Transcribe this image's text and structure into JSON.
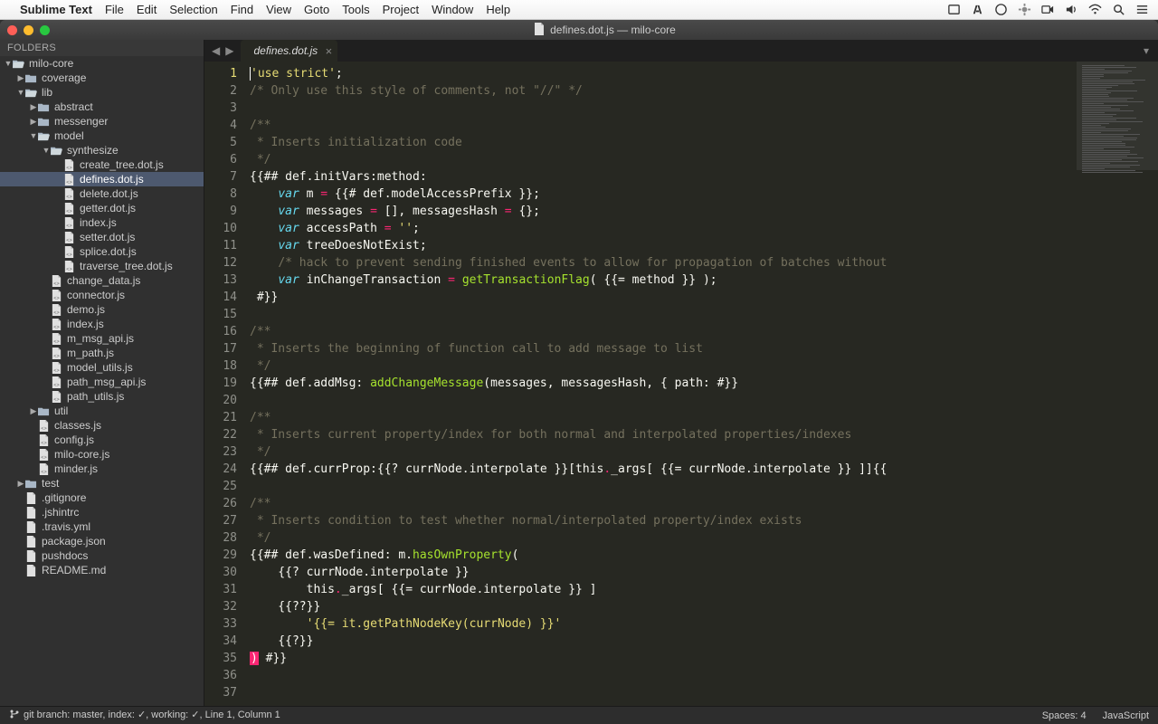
{
  "menubar": {
    "app_name": "Sublime Text",
    "items": [
      "File",
      "Edit",
      "Selection",
      "Find",
      "View",
      "Goto",
      "Tools",
      "Project",
      "Window",
      "Help"
    ]
  },
  "window": {
    "title": "defines.dot.js — milo-core"
  },
  "sidebar": {
    "header": "FOLDERS",
    "tree": [
      {
        "d": 0,
        "t": "folder-open",
        "label": "milo-core"
      },
      {
        "d": 1,
        "t": "folder",
        "label": "coverage"
      },
      {
        "d": 1,
        "t": "folder-open",
        "label": "lib"
      },
      {
        "d": 2,
        "t": "folder",
        "label": "abstract"
      },
      {
        "d": 2,
        "t": "folder",
        "label": "messenger"
      },
      {
        "d": 2,
        "t": "folder-open",
        "label": "model"
      },
      {
        "d": 3,
        "t": "folder-open",
        "label": "synthesize"
      },
      {
        "d": 4,
        "t": "file-js",
        "label": "create_tree.dot.js"
      },
      {
        "d": 4,
        "t": "file-js",
        "label": "defines.dot.js",
        "selected": true
      },
      {
        "d": 4,
        "t": "file-js",
        "label": "delete.dot.js"
      },
      {
        "d": 4,
        "t": "file-js",
        "label": "getter.dot.js"
      },
      {
        "d": 4,
        "t": "file-js",
        "label": "index.js"
      },
      {
        "d": 4,
        "t": "file-js",
        "label": "setter.dot.js"
      },
      {
        "d": 4,
        "t": "file-js",
        "label": "splice.dot.js"
      },
      {
        "d": 4,
        "t": "file-js",
        "label": "traverse_tree.dot.js"
      },
      {
        "d": 3,
        "t": "file-js",
        "label": "change_data.js"
      },
      {
        "d": 3,
        "t": "file-js",
        "label": "connector.js"
      },
      {
        "d": 3,
        "t": "file-js",
        "label": "demo.js"
      },
      {
        "d": 3,
        "t": "file-js",
        "label": "index.js"
      },
      {
        "d": 3,
        "t": "file-js",
        "label": "m_msg_api.js"
      },
      {
        "d": 3,
        "t": "file-js",
        "label": "m_path.js"
      },
      {
        "d": 3,
        "t": "file-js",
        "label": "model_utils.js"
      },
      {
        "d": 3,
        "t": "file-js",
        "label": "path_msg_api.js"
      },
      {
        "d": 3,
        "t": "file-js",
        "label": "path_utils.js"
      },
      {
        "d": 2,
        "t": "folder",
        "label": "util"
      },
      {
        "d": 2,
        "t": "file-js",
        "label": "classes.js"
      },
      {
        "d": 2,
        "t": "file-js",
        "label": "config.js"
      },
      {
        "d": 2,
        "t": "file-js",
        "label": "milo-core.js"
      },
      {
        "d": 2,
        "t": "file-js",
        "label": "minder.js"
      },
      {
        "d": 1,
        "t": "folder",
        "label": "test"
      },
      {
        "d": 1,
        "t": "file",
        "label": ".gitignore"
      },
      {
        "d": 1,
        "t": "file",
        "label": ".jshintrc"
      },
      {
        "d": 1,
        "t": "file",
        "label": ".travis.yml"
      },
      {
        "d": 1,
        "t": "file",
        "label": "package.json"
      },
      {
        "d": 1,
        "t": "file",
        "label": "pushdocs"
      },
      {
        "d": 1,
        "t": "file",
        "label": "README.md"
      }
    ]
  },
  "tabs": {
    "current": "defines.dot.js"
  },
  "editor": {
    "line_count": 37,
    "lines": [
      {
        "n": 1,
        "spans": [
          [
            "str",
            "'use strict'"
          ],
          [
            "pun",
            ";"
          ]
        ]
      },
      {
        "n": 2,
        "spans": [
          [
            "com",
            "/* Only use this style of comments, not \"//\" */"
          ]
        ]
      },
      {
        "n": 3,
        "spans": []
      },
      {
        "n": 4,
        "spans": [
          [
            "com",
            "/**"
          ]
        ]
      },
      {
        "n": 5,
        "spans": [
          [
            "com",
            " * Inserts initialization code"
          ]
        ]
      },
      {
        "n": 6,
        "spans": [
          [
            "com",
            " */"
          ]
        ]
      },
      {
        "n": 7,
        "spans": [
          [
            "pun",
            "{{## def.initVars:method:"
          ]
        ]
      },
      {
        "n": 8,
        "spans": [
          [
            "pun",
            "    "
          ],
          [
            "kw",
            "var"
          ],
          [
            "id",
            " m "
          ],
          [
            "op",
            "="
          ],
          [
            "id",
            " {{# def.modelAccessPrefix }};"
          ]
        ]
      },
      {
        "n": 9,
        "spans": [
          [
            "pun",
            "    "
          ],
          [
            "kw",
            "var"
          ],
          [
            "id",
            " messages "
          ],
          [
            "op",
            "="
          ],
          [
            "id",
            " [], messagesHash "
          ],
          [
            "op",
            "="
          ],
          [
            "id",
            " {};"
          ]
        ]
      },
      {
        "n": 10,
        "spans": [
          [
            "pun",
            "    "
          ],
          [
            "kw",
            "var"
          ],
          [
            "id",
            " accessPath "
          ],
          [
            "op",
            "="
          ],
          [
            "id",
            " "
          ],
          [
            "str",
            "''"
          ],
          [
            "pun",
            ";"
          ]
        ]
      },
      {
        "n": 11,
        "spans": [
          [
            "pun",
            "    "
          ],
          [
            "kw",
            "var"
          ],
          [
            "id",
            " treeDoesNotExist;"
          ]
        ]
      },
      {
        "n": 12,
        "spans": [
          [
            "pun",
            "    "
          ],
          [
            "com",
            "/* hack to prevent sending finished events to allow for propagation of batches without"
          ]
        ]
      },
      {
        "n": 13,
        "spans": [
          [
            "pun",
            "    "
          ],
          [
            "kw",
            "var"
          ],
          [
            "id",
            " inChangeTransaction "
          ],
          [
            "op",
            "="
          ],
          [
            "id",
            " "
          ],
          [
            "fn",
            "getTransactionFlag"
          ],
          [
            "pun",
            "( {{= method }} );"
          ]
        ]
      },
      {
        "n": 14,
        "spans": [
          [
            "pun",
            " #}}"
          ]
        ]
      },
      {
        "n": 15,
        "spans": []
      },
      {
        "n": 16,
        "spans": [
          [
            "com",
            "/**"
          ]
        ]
      },
      {
        "n": 17,
        "spans": [
          [
            "com",
            " * Inserts the beginning of function call to add message to list"
          ]
        ]
      },
      {
        "n": 18,
        "spans": [
          [
            "com",
            " */"
          ]
        ]
      },
      {
        "n": 19,
        "spans": [
          [
            "pun",
            "{{## def.addMsg: "
          ],
          [
            "fn",
            "addChangeMessage"
          ],
          [
            "pun",
            "(messages, messagesHash, { path: #}}"
          ]
        ]
      },
      {
        "n": 20,
        "spans": []
      },
      {
        "n": 21,
        "spans": [
          [
            "com",
            "/**"
          ]
        ]
      },
      {
        "n": 22,
        "spans": [
          [
            "com",
            " * Inserts current property/index for both normal and interpolated properties/indexes"
          ]
        ]
      },
      {
        "n": 23,
        "spans": [
          [
            "com",
            " */"
          ]
        ]
      },
      {
        "n": 24,
        "spans": [
          [
            "pun",
            "{{## def.currProp:{{? currNode.interpolate }}[this"
          ],
          [
            "op",
            "."
          ],
          [
            "id",
            "_args[ {{= currNode.interpolate }} ]]{{"
          ]
        ]
      },
      {
        "n": 25,
        "spans": []
      },
      {
        "n": 26,
        "spans": [
          [
            "com",
            "/**"
          ]
        ]
      },
      {
        "n": 27,
        "spans": [
          [
            "com",
            " * Inserts condition to test whether normal/interpolated property/index exists"
          ]
        ]
      },
      {
        "n": 28,
        "spans": [
          [
            "com",
            " */"
          ]
        ]
      },
      {
        "n": 29,
        "spans": [
          [
            "pun",
            "{{## def.wasDefined: m."
          ],
          [
            "fn",
            "hasOwnProperty"
          ],
          [
            "pun",
            "("
          ]
        ]
      },
      {
        "n": 30,
        "spans": [
          [
            "pun",
            "    {{? currNode.interpolate }}"
          ]
        ]
      },
      {
        "n": 31,
        "spans": [
          [
            "pun",
            "        this"
          ],
          [
            "op",
            "."
          ],
          [
            "id",
            "_args[ {{= currNode.interpolate }} ]"
          ]
        ]
      },
      {
        "n": 32,
        "spans": [
          [
            "pun",
            "    {{??}}"
          ]
        ]
      },
      {
        "n": 33,
        "spans": [
          [
            "pun",
            "        "
          ],
          [
            "str",
            "'{{= it.getPathNodeKey(currNode) }}'"
          ]
        ]
      },
      {
        "n": 34,
        "spans": [
          [
            "pun",
            "    {{?}}"
          ]
        ]
      },
      {
        "n": 35,
        "spans": [
          [
            "hl-pink",
            ")"
          ],
          [
            "pun",
            " #}}"
          ]
        ]
      },
      {
        "n": 36,
        "spans": []
      },
      {
        "n": 37,
        "spans": []
      }
    ]
  },
  "statusbar": {
    "left": "git branch: master, index: ✓, working: ✓, Line 1, Column 1",
    "spaces": "Spaces: 4",
    "syntax": "JavaScript"
  }
}
